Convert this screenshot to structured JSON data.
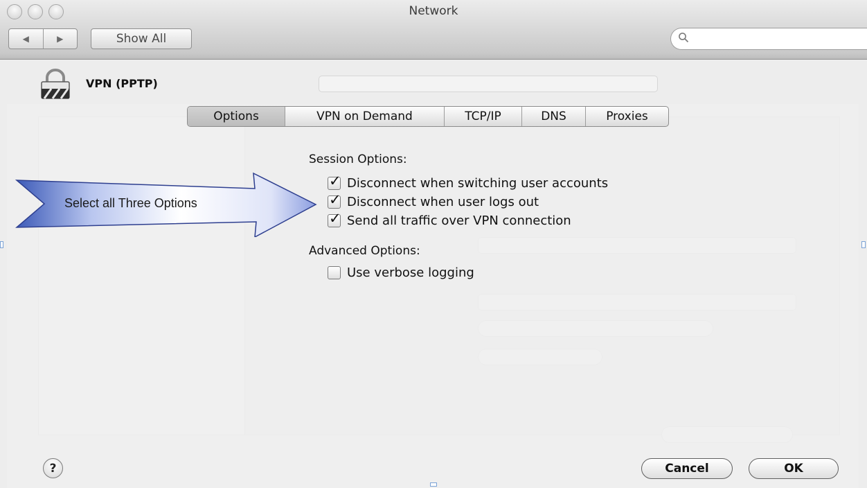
{
  "window": {
    "title": "Network",
    "nav_back": "◀",
    "nav_forward": "▶",
    "show_all": "Show All",
    "search_placeholder": ""
  },
  "service": {
    "name": "VPN (PPTP)",
    "icon": "lock-icon"
  },
  "tabs": [
    {
      "label": "Options",
      "selected": true
    },
    {
      "label": "VPN on Demand",
      "selected": false
    },
    {
      "label": "TCP/IP",
      "selected": false
    },
    {
      "label": "DNS",
      "selected": false
    },
    {
      "label": "Proxies",
      "selected": false
    }
  ],
  "session": {
    "heading": "Session Options:",
    "options": [
      {
        "label": "Disconnect when switching user accounts",
        "checked": true
      },
      {
        "label": "Disconnect when user logs out",
        "checked": true
      },
      {
        "label": "Send all traffic over VPN connection",
        "checked": true
      }
    ]
  },
  "advanced": {
    "heading": "Advanced Options:",
    "options": [
      {
        "label": "Use verbose logging",
        "checked": false
      }
    ]
  },
  "callout": {
    "text": "Select all Three Options",
    "fill_start": "#3d5bb8",
    "fill_end": "#ffffff"
  },
  "footer": {
    "help": "?",
    "cancel": "Cancel",
    "ok": "OK"
  }
}
